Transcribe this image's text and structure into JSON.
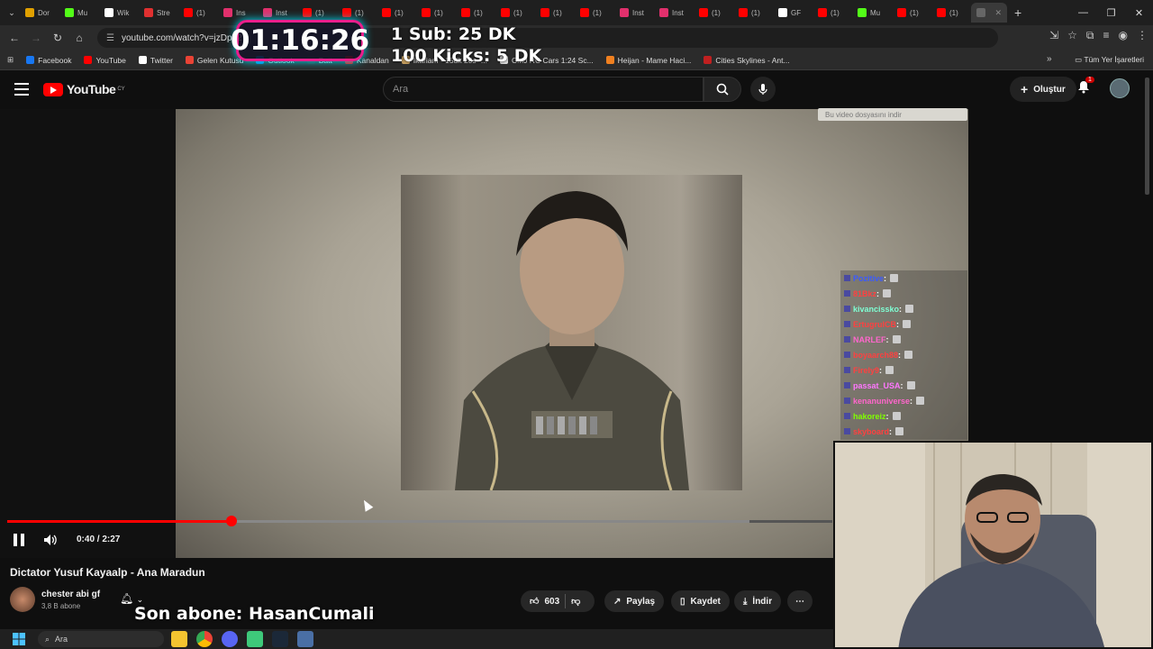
{
  "browser": {
    "tabs": [
      {
        "label": "Dor",
        "color": "#e0a000"
      },
      {
        "label": "Mu",
        "color": "#53fc18"
      },
      {
        "label": "Wik",
        "color": "#ffffff"
      },
      {
        "label": "Stre",
        "color": "#e03030"
      },
      {
        "label": "(1)",
        "color": "#ff0000"
      },
      {
        "label": "Ins",
        "color": "#e1306c"
      },
      {
        "label": "Inst",
        "color": "#e1306c"
      },
      {
        "label": "(1)",
        "color": "#ff0000"
      },
      {
        "label": "(1)",
        "color": "#ff0000"
      },
      {
        "label": "(1)",
        "color": "#ff0000"
      },
      {
        "label": "(1)",
        "color": "#ff0000"
      },
      {
        "label": "(1)",
        "color": "#ff0000"
      },
      {
        "label": "(1)",
        "color": "#ff0000"
      },
      {
        "label": "(1)",
        "color": "#ff0000"
      },
      {
        "label": "(1)",
        "color": "#ff0000"
      },
      {
        "label": "Inst",
        "color": "#e1306c"
      },
      {
        "label": "Inst",
        "color": "#e1306c"
      },
      {
        "label": "(1)",
        "color": "#ff0000"
      },
      {
        "label": "(1)",
        "color": "#ff0000"
      },
      {
        "label": "GF",
        "color": "#ffffff"
      },
      {
        "label": "(1)",
        "color": "#ff0000"
      },
      {
        "label": "Mu",
        "color": "#53fc18"
      },
      {
        "label": "(1)",
        "color": "#ff0000"
      },
      {
        "label": "(1)",
        "color": "#ff0000"
      }
    ],
    "url": "youtube.com/watch?v=jzDp82",
    "bookmarks": [
      {
        "label": "Facebook",
        "color": "#1877f2"
      },
      {
        "label": "YouTube",
        "color": "#ff0000"
      },
      {
        "label": "Twitter",
        "color": "#ffffff"
      },
      {
        "label": "Gelen Kutusu",
        "color": "#ea4335"
      },
      {
        "label": "Outlook",
        "color": "#0078d4"
      },
      {
        "label": "Batt",
        "color": "#333333"
      },
      {
        "label": "Kanaldan",
        "color": "#ff0000"
      },
      {
        "label": "Ikariam - 15dk 20s -...",
        "color": "#c8a060"
      },
      {
        "label": "CMJ RC Cars 1:24 Sc...",
        "color": "#dddddd"
      },
      {
        "label": "Heijan - Mame Haci...",
        "color": "#f08020"
      },
      {
        "label": "Cities Skylines - Ant...",
        "color": "#c02020"
      }
    ],
    "bookmarks_right": "Tüm Yer İşaretleri"
  },
  "overlay": {
    "timer": "01:16:26",
    "line1": "1 Sub: 25 DK",
    "line2": "100 Kicks: 5 DK",
    "son_abone": "Son abone: HasanCumali"
  },
  "youtube": {
    "logo_text": "YouTube",
    "logo_region": "CY",
    "search_placeholder": "Ara",
    "create_label": "Oluştur",
    "notification_count": "1",
    "download_hint": "Bu video dosyasını indir"
  },
  "chat": [
    {
      "name": "Pozitive",
      "color": "#3a5aff"
    },
    {
      "name": "81Bkz",
      "color": "#ff4040"
    },
    {
      "name": "kivancissko",
      "color": "#7fffd4"
    },
    {
      "name": "ErtugrulCB",
      "color": "#ff4040"
    },
    {
      "name": "NARLEF",
      "color": "#ff66cc"
    },
    {
      "name": "boyaarch88",
      "color": "#ff4040"
    },
    {
      "name": "Firely9",
      "color": "#ff4040"
    },
    {
      "name": "passat_USA",
      "color": "#ff77ff"
    },
    {
      "name": "kenanuniverse",
      "color": "#ff66cc"
    },
    {
      "name": "hakoreiz",
      "color": "#7fff00"
    },
    {
      "name": "skyboard",
      "color": "#ff4040"
    }
  ],
  "player": {
    "current_time": "0:40",
    "duration": "2:27",
    "time_display": "0:40 / 2:27",
    "progress_fraction": 0.272,
    "buffer_fraction": 0.9
  },
  "video": {
    "title": "Dictator Yusuf Kayaalp - Ana Maradun",
    "channel": "chester abi gf",
    "subscribers": "3,8 B abone",
    "likes": "603",
    "share_label": "Paylaş",
    "save_label": "Kaydet",
    "download_label": "İndir"
  },
  "taskbar": {
    "search_label": "Ara"
  }
}
